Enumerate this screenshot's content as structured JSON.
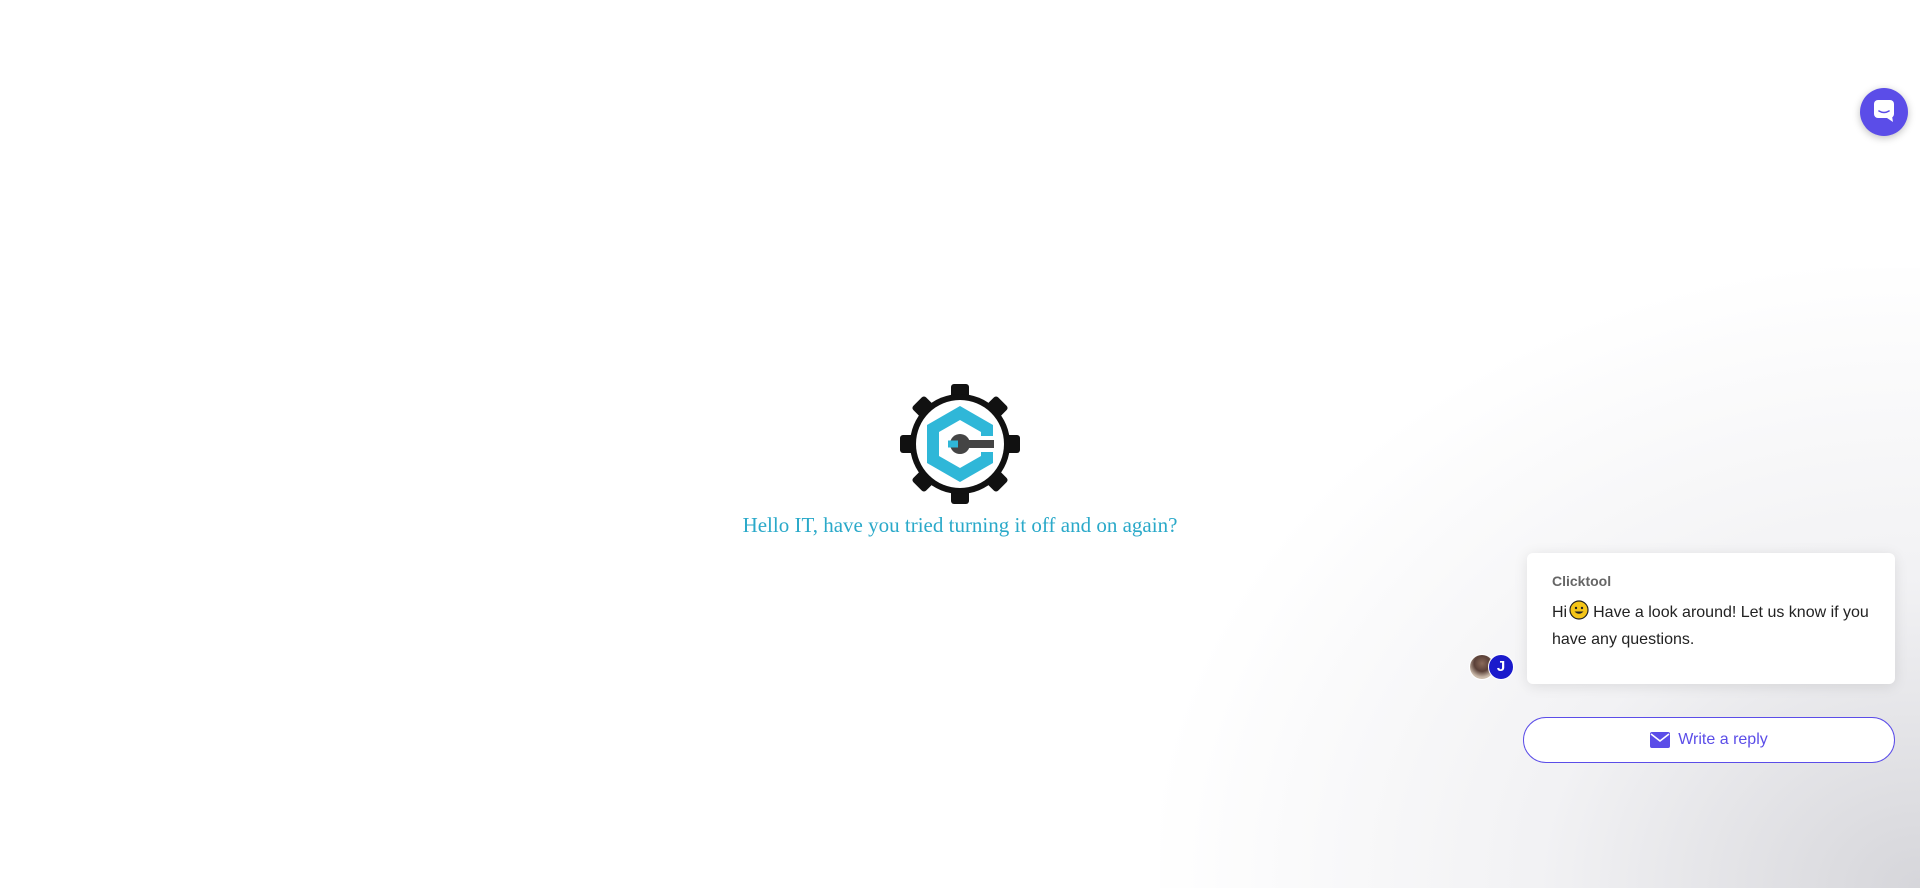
{
  "hero": {
    "tagline": "Hello IT, have you tried turning it off and on again?",
    "logo_icon": "gear-wrench-logo",
    "tagline_color": "#2aa9c9"
  },
  "messenger": {
    "launcher_icon": "chat-bubble-icon",
    "accent_color": "#5b4de8",
    "card": {
      "sender": "Clicktool",
      "greeting": "Hi",
      "message": "Have a look around! Let us know if you have any questions."
    },
    "avatars": [
      {
        "type": "photo"
      },
      {
        "type": "initial",
        "initial": "J",
        "color": "#1a1acc"
      }
    ],
    "reply_button": {
      "label": "Write a reply",
      "icon": "envelope-icon"
    }
  }
}
